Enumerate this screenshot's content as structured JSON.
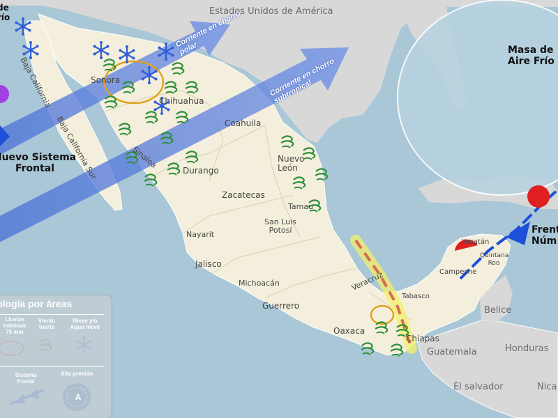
{
  "map": {
    "labels": {
      "usa": "Estados Unidos de América",
      "baja_california": "Baja California",
      "baja_california_sur": "Baja California Sur",
      "sonora": "Sonora",
      "chihuahua": "Chihuahua",
      "coahuila": "Coahuila",
      "nuevo_leon": "Nuevo León",
      "sinaloa": "Sinaloa",
      "durango": "Durango",
      "zacatecas": "Zacatecas",
      "tamaulipas": "Tamau",
      "san_luis_potosi": "San Luis Potosí",
      "nayarit": "Nayarit",
      "jalisco": "Jalisco",
      "michoacan": "Michoacán",
      "guerrero": "Guerrero",
      "oaxaca": "Oaxaca",
      "veracruz": "Veracruz",
      "chiapas": "Chiapas",
      "tabasco": "Tabasco",
      "campeche": "Campeche",
      "yucatan": "Yucatán",
      "quintana_roo": "Quintana Roo",
      "belice": "Belice",
      "guatemala": "Guatemala",
      "honduras": "Honduras",
      "el_salvador": "El salvador",
      "nicaragua": "Nica",
      "masa_aire_frio": "Masa de Aire Frío",
      "frente": "Frent Núm",
      "nuevo_sistema_frontal": "Nuevo Sistema Frontal",
      "top_left_fragment": "de río"
    },
    "jet_streams": {
      "polar": "Corriente en chorro polar",
      "subtropical": "Corriente en chorro subtropical"
    },
    "colors": {
      "ocean": "#a9c7d6",
      "land_mexico": "#f4efdc",
      "land_neighbors": "#d9d9d9",
      "jet_stream": "#4a6fd6",
      "wind_symbol": "#2e8f3a",
      "snow_symbol": "#2f5fd8",
      "rain_circle": "#e0a21b",
      "trough_dash": "#d86a55",
      "trough_glow": "#f3f06a",
      "cold_front": "#1e4fd8",
      "warm_front": "#e02020",
      "high_pressure": "#3a6fb0",
      "low_pressure": "#a040e0"
    }
  },
  "legend": {
    "title": "ología por áreas",
    "rain": "Lluvias intensas 75 mm",
    "wind": "Viento fuerte",
    "snow": "Nieve y/o Agua nieve",
    "front": "Sistema frontal",
    "high": "Alta presión",
    "high_symbol": "A"
  }
}
